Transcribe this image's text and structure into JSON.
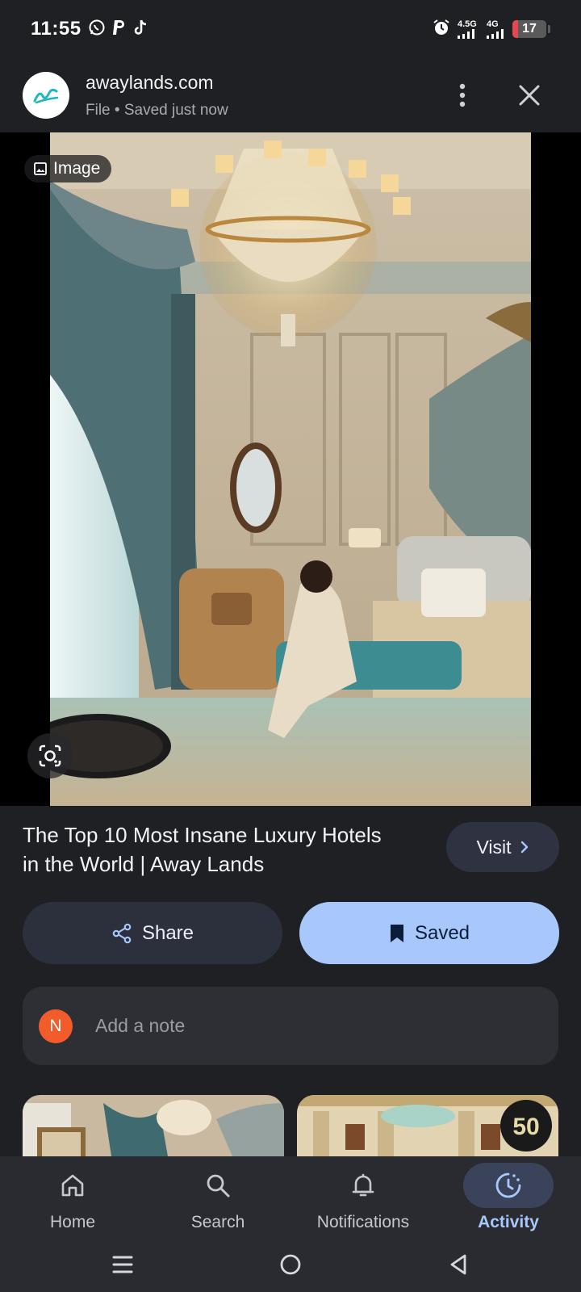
{
  "status_bar": {
    "time": "11:55",
    "notification_icons": [
      "whatsapp-icon",
      "paypal-icon",
      "tiktok-icon"
    ],
    "alarm_icon": "alarm-icon",
    "signal_1": "4.5G",
    "signal_2": "4G",
    "battery_level": "17",
    "battery_fraction": 0.17
  },
  "header": {
    "site_name": "awaylands.com",
    "subtitle": "File • Saved just now",
    "more_icon": "more-vert-icon",
    "close_icon": "close-icon"
  },
  "image": {
    "chip_label": "Image",
    "lens_icon": "google-lens-icon"
  },
  "result": {
    "title": "The Top 10 Most Insane Luxury Hotels in the World | Away Lands",
    "visit_label": "Visit"
  },
  "actions": {
    "share_label": "Share",
    "saved_label": "Saved"
  },
  "note": {
    "avatar_letter": "N",
    "placeholder": "Add a note"
  },
  "related": {
    "badge_text": "50"
  },
  "bottom_nav": {
    "items": [
      {
        "label": "Home",
        "icon": "home-icon"
      },
      {
        "label": "Search",
        "icon": "search-icon"
      },
      {
        "label": "Notifications",
        "icon": "bell-icon"
      },
      {
        "label": "Activity",
        "icon": "activity-icon",
        "active": true
      }
    ]
  },
  "colors": {
    "background": "#1f2024",
    "accent": "#a8c7fa",
    "avatar": "#f25c2a",
    "battery_low": "#e5484d"
  }
}
